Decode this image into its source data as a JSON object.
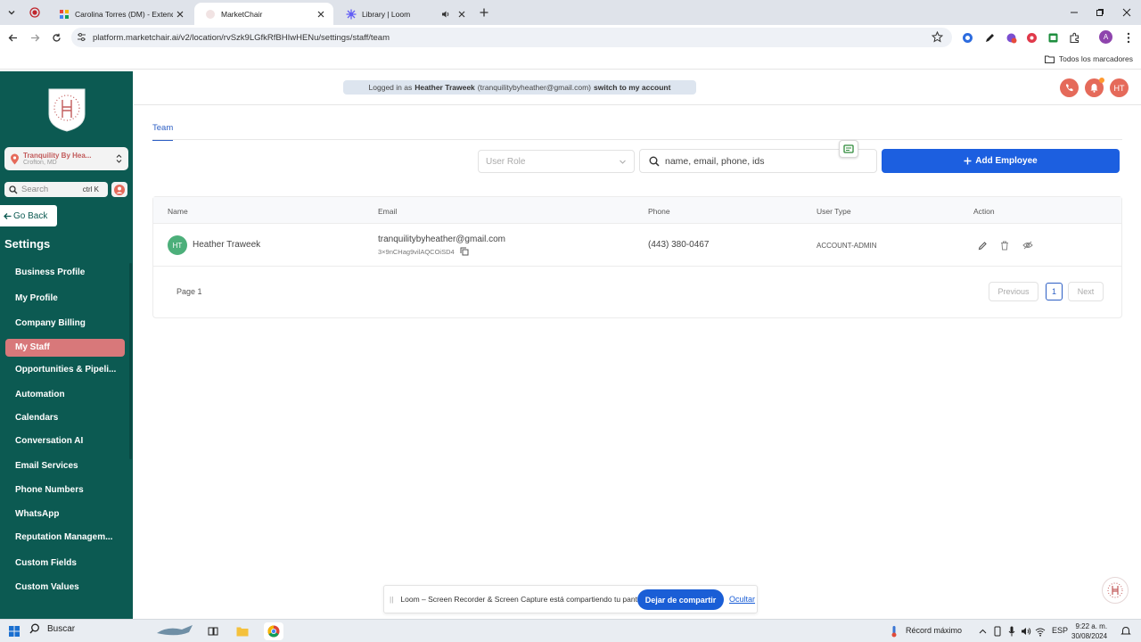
{
  "browser": {
    "tabs": [
      {
        "title": "Carolina Torres (DM) - Extendly",
        "active": false
      },
      {
        "title": "MarketChair",
        "active": true
      },
      {
        "title": "Library | Loom",
        "active": false
      }
    ],
    "url": "platform.marketchair.ai/v2/location/rvSzk9LGfkRfBHIwHENu/settings/staff/team",
    "bookmarks_folder": "Todos los marcadores",
    "profile_initial": "A"
  },
  "sidebar": {
    "location_name": "Tranquility By Hea...",
    "location_city": "Crofton, MD",
    "search_placeholder": "Search",
    "search_shortcut": "ctrl K",
    "go_back": "Go Back",
    "section_title": "Settings",
    "items": [
      {
        "label": "Business Profile",
        "active": false
      },
      {
        "label": "My Profile",
        "active": false
      },
      {
        "label": "Company Billing",
        "active": false
      },
      {
        "label": "My Staff",
        "active": true
      },
      {
        "label": "Opportunities & Pipeli...",
        "active": false
      },
      {
        "label": "Automation",
        "active": false
      },
      {
        "label": "Calendars",
        "active": false
      },
      {
        "label": "Conversation AI",
        "active": false
      },
      {
        "label": "Email Services",
        "active": false
      },
      {
        "label": "Phone Numbers",
        "active": false
      },
      {
        "label": "WhatsApp",
        "active": false
      },
      {
        "label": "Reputation Managem...",
        "active": false
      },
      {
        "label": "Custom Fields",
        "active": false
      },
      {
        "label": "Custom Values",
        "active": false
      }
    ]
  },
  "header": {
    "logged_prefix": "Logged in as",
    "logged_user": "Heather Traweek",
    "logged_email": "(tranquilitybyheather@gmail.com)",
    "switch_label": "switch to my account",
    "avatar_initials": "HT"
  },
  "main": {
    "tab_label": "Team",
    "role_placeholder": "User Role",
    "search_placeholder": "name, email, phone, ids",
    "add_button": "Add Employee",
    "columns": [
      "Name",
      "Email",
      "Phone",
      "User Type",
      "Action"
    ],
    "rows": [
      {
        "initials": "HT",
        "name": "Heather Traweek",
        "email": "tranquilitybyheather@gmail.com",
        "id": "3×9nCHag9vilAQCOiSD4",
        "phone": "(443) 380-0467",
        "user_type": "ACCOUNT-ADMIN"
      }
    ],
    "page_label": "Page 1",
    "prev": "Previous",
    "current_page": "1",
    "next": "Next"
  },
  "loom": {
    "message": "Loom – Screen Recorder & Screen Capture está compartiendo tu pantalla.",
    "stop": "Dejar de compartir",
    "hide": "Ocultar"
  },
  "taskbar": {
    "search": "Buscar",
    "weather": "Récord máximo",
    "lang": "ESP",
    "time": "9:22 a. m.",
    "date": "30/08/2024"
  },
  "colors": {
    "sidebar": "#0c5a52",
    "active_item": "#d8787a",
    "primary": "#1c5fe0",
    "accent_orange": "#e56a5a"
  }
}
